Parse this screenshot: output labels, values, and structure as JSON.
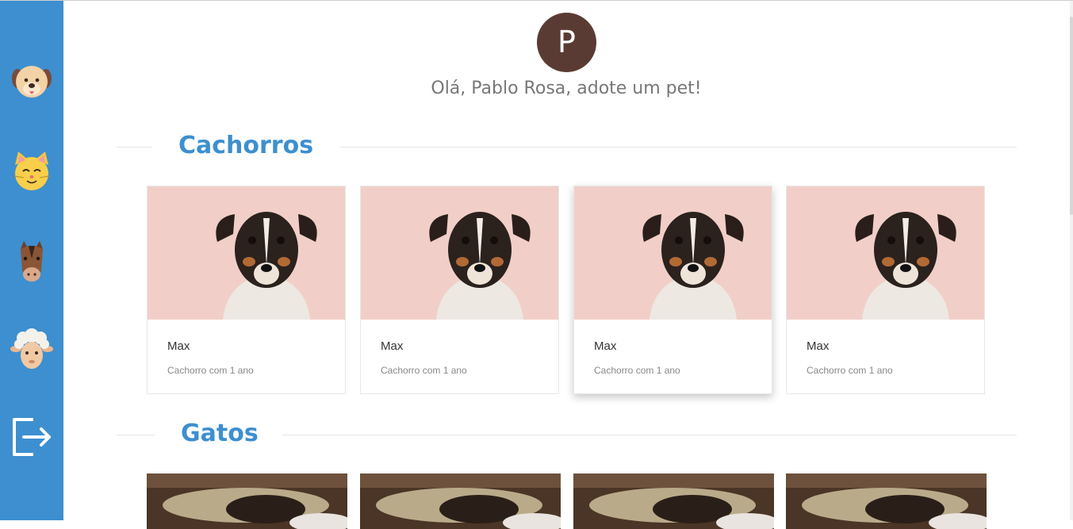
{
  "sidebar": {
    "items": [
      {
        "name": "dog",
        "icon": "dog-face-icon"
      },
      {
        "name": "cat",
        "icon": "cat-face-icon"
      },
      {
        "name": "horse",
        "icon": "horse-face-icon"
      },
      {
        "name": "sheep",
        "icon": "sheep-face-icon"
      },
      {
        "name": "logout",
        "icon": "logout-icon"
      }
    ]
  },
  "user": {
    "avatar_initial": "P",
    "greeting": "Olá, Pablo Rosa, adote um pet!"
  },
  "sections": [
    {
      "title": "Cachorros",
      "cards": [
        {
          "name": "Max",
          "description": "Cachorro com 1 ano"
        },
        {
          "name": "Max",
          "description": "Cachorro com 1 ano"
        },
        {
          "name": "Max",
          "description": "Cachorro com 1 ano"
        },
        {
          "name": "Max",
          "description": "Cachorro com 1 ano"
        }
      ]
    },
    {
      "title": "Gatos",
      "cards": [
        {},
        {},
        {},
        {}
      ]
    }
  ],
  "colors": {
    "sidebar": "#3d8fcf",
    "accent": "#3d8fcf",
    "avatar": "#5a3b33",
    "greeting": "#777777"
  }
}
